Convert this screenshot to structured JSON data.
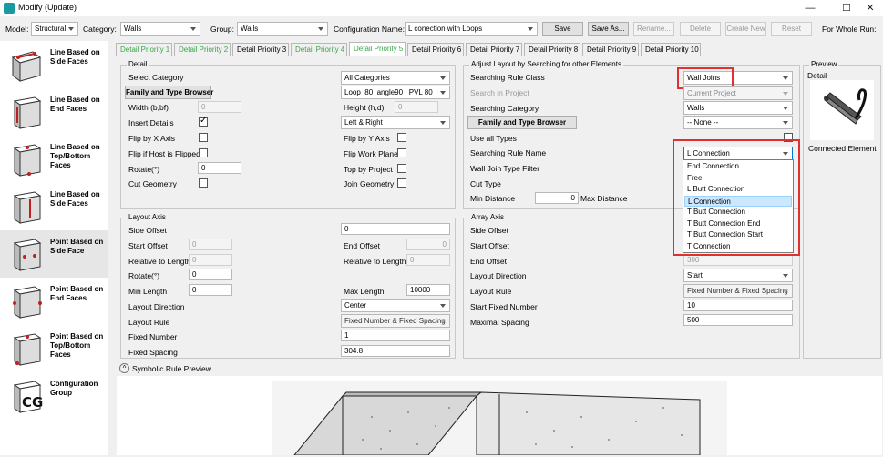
{
  "window": {
    "title": "Modify (Update)",
    "minimize": "—",
    "maximize": "☐",
    "close": "✕"
  },
  "topbar": {
    "model_label": "Model:",
    "model_value": "Structural",
    "category_label": "Category:",
    "category_value": "Walls",
    "group_label": "Group:",
    "group_value": "Walls",
    "config_label": "Configuration Name:",
    "config_value": "L conection with Loops",
    "save": "Save",
    "save_as": "Save As...",
    "rename": "Rename...",
    "delete": "Delete",
    "create_new": "Create New",
    "reset": "Reset",
    "for_whole_run": "For Whole Run:"
  },
  "tabs": [
    {
      "label": "Detail Priority 1",
      "green": true
    },
    {
      "label": "Detail Priority 2",
      "green": true
    },
    {
      "label": "Detail Priority 3",
      "green": false
    },
    {
      "label": "Detail Priority 4",
      "green": true
    },
    {
      "label": "Detail Priority 5",
      "green": true,
      "active": true
    },
    {
      "label": "Detail Priority 6",
      "green": false
    },
    {
      "label": "Detail Priority 7",
      "green": false
    },
    {
      "label": "Detail Priority 8",
      "green": false
    },
    {
      "label": "Detail Priority 9",
      "green": false
    },
    {
      "label": "Detail Priority 10",
      "green": false
    }
  ],
  "sidebar": {
    "items": [
      {
        "label": "Line Based on Side Faces",
        "icon": "line-side-faces-icon"
      },
      {
        "label": "Line Based on End Faces",
        "icon": "line-end-faces-icon"
      },
      {
        "label": "Line Based on Top/Bottom Faces",
        "icon": "line-top-bottom-faces-icon"
      },
      {
        "label": "Line Based on Side Faces",
        "icon": "line-side-faces-2-icon"
      },
      {
        "label": "Point Based on Side Face",
        "icon": "point-side-face-icon"
      },
      {
        "label": "Point Based on End Faces",
        "icon": "point-end-faces-icon"
      },
      {
        "label": "Point Based on Top/Bottom Faces",
        "icon": "point-top-bottom-faces-icon"
      },
      {
        "label": "Configuration Group",
        "icon": "cg-icon"
      }
    ]
  },
  "detail": {
    "title": "Detail",
    "select_category": "Select Category",
    "select_category_value": "All Categories",
    "family_type_browser": "Family and Type Browser",
    "family_value": "Loop_80_angle90 : PVL 80",
    "width_label": "Width (b,bf)",
    "width_value": "0",
    "height_label": "Height (h,d)",
    "height_value": "0",
    "insert_details": "Insert Details",
    "insert_align": "Left & Right",
    "flip_x": "Flip by X Axis",
    "flip_y": "Flip by Y Axis",
    "flip_host": "Flip if Host is Flipped",
    "flip_work_plane": "Flip Work Plane",
    "rotate": "Rotate(°)",
    "rotate_value": "0",
    "top_by_project": "Top by Project",
    "cut_geometry": "Cut Geometry",
    "join_geometry": "Join Geometry"
  },
  "adjust": {
    "title": "Adjust Layout by Searching for other Elements",
    "rule_class_label": "Searching Rule Class",
    "rule_class_value": "Wall Joins",
    "search_in_project_label": "Search in Project",
    "search_in_project_value": "Current Project",
    "category_label": "Searching Category",
    "category_value": "Walls",
    "family_browser": "Family and Type Browser",
    "family_value": "-- None --",
    "use_all_types": "Use all Types",
    "rule_name_label": "Searching Rule Name",
    "rule_name_value": "L Connection",
    "join_filter_label": "Wall Join Type Filter",
    "cut_type_label": "Cut Type",
    "min_distance_label": "Min Distance",
    "min_distance_value": "0",
    "max_distance_label": "Max Distance",
    "dropdown_options": [
      "End Connection",
      "Free",
      "L Butt Connection",
      "L Connection",
      "T Butt Connection",
      "T Butt Connection End",
      "T Butt Connection Start",
      "T Connection"
    ],
    "dropdown_selected_index": 3
  },
  "preview": {
    "title": "Preview",
    "detail_label": "Detail",
    "caption": "Connected Element"
  },
  "layout_axis": {
    "title": "Layout Axis",
    "side_offset": "Side Offset",
    "side_offset_value": "0",
    "start_offset": "Start Offset",
    "start_offset_value": "0",
    "end_offset": "End Offset",
    "end_offset_value": "0",
    "rel_length_start": "Relative to Length",
    "rel_length_start_value": "0",
    "rel_length_end": "Relative to Length",
    "rel_length_end_value": "0",
    "rotate": "Rotate(°)",
    "rotate_value": "0",
    "min_length": "Min Length",
    "min_length_value": "0",
    "max_length": "Max Length",
    "max_length_value": "10000",
    "direction": "Layout Direction",
    "direction_value": "Center",
    "rule": "Layout Rule",
    "rule_value": "Fixed Number & Fixed Spacing",
    "fixed_number": "Fixed Number",
    "fixed_number_value": "1",
    "fixed_spacing": "Fixed Spacing",
    "fixed_spacing_value": "304.8"
  },
  "array_axis": {
    "title": "Array Axis",
    "side_offset": "Side Offset",
    "start_offset": "Start Offset",
    "end_offset": "End Offset",
    "end_offset_value": "300",
    "direction": "Layout Direction",
    "direction_value": "Start",
    "rule": "Layout Rule",
    "rule_value": "Fixed Number & Fixed Spacing",
    "start_fixed_number": "Start Fixed Number",
    "start_fixed_number_value": "10",
    "maximal_spacing": "Maximal Spacing",
    "maximal_spacing_value": "500"
  },
  "symbolic": {
    "title": "Symbolic Rule Preview",
    "toggle": "^"
  }
}
